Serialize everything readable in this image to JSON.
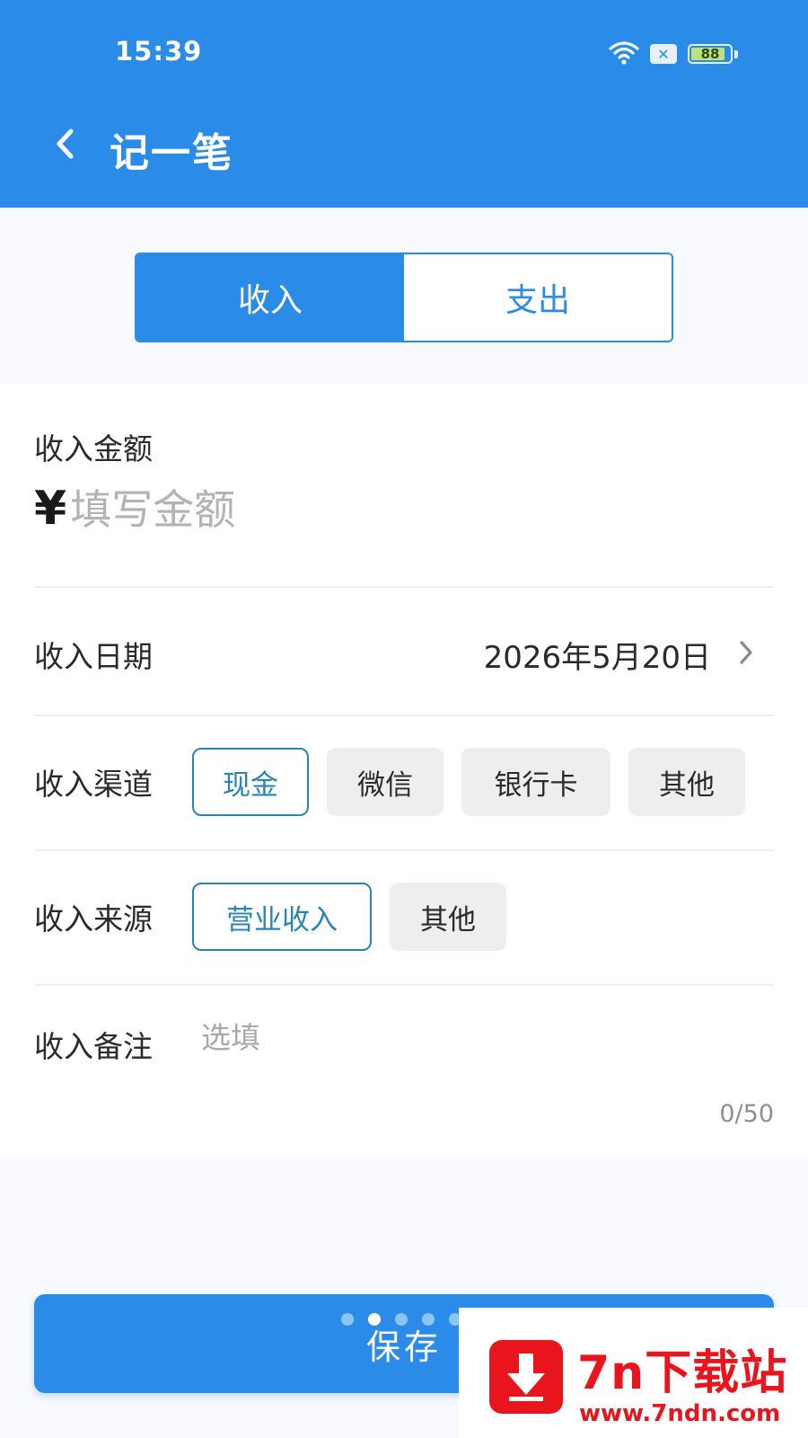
{
  "status_bar": {
    "time": "15:39",
    "battery_level": "88",
    "icons": [
      "wifi-icon",
      "sim-no-signal-icon",
      "battery-icon"
    ]
  },
  "header": {
    "back_icon": "chevron-left-icon",
    "title": "记一笔",
    "background_color": "#2a8ce8"
  },
  "type_tabs": [
    {
      "label": "收入",
      "active": true
    },
    {
      "label": "支出",
      "active": false
    }
  ],
  "form": {
    "amount": {
      "label": "收入金额",
      "currency_symbol": "¥",
      "value": "",
      "placeholder": "填写金额"
    },
    "date": {
      "label": "收入日期",
      "value": "2026年5月20日",
      "icon": "chevron-right-icon"
    },
    "channel": {
      "label": "收入渠道",
      "options": [
        {
          "label": "现金",
          "selected": true
        },
        {
          "label": "微信",
          "selected": false
        },
        {
          "label": "银行卡",
          "selected": false
        },
        {
          "label": "其他",
          "selected": false
        }
      ]
    },
    "source": {
      "label": "收入来源",
      "options": [
        {
          "label": "营业收入",
          "selected": true
        },
        {
          "label": "其他",
          "selected": false
        }
      ]
    },
    "remark": {
      "label": "收入备注",
      "value": "",
      "placeholder": "选填",
      "counter": "0/50"
    }
  },
  "save_button": {
    "label": "保存"
  },
  "carousel_dots": {
    "count": 5,
    "active_index": 1
  },
  "watermark": {
    "title": "7n下载站",
    "url": "www.7ndn.com",
    "icon": "download-arrow-icon",
    "color": "#e8161c"
  }
}
